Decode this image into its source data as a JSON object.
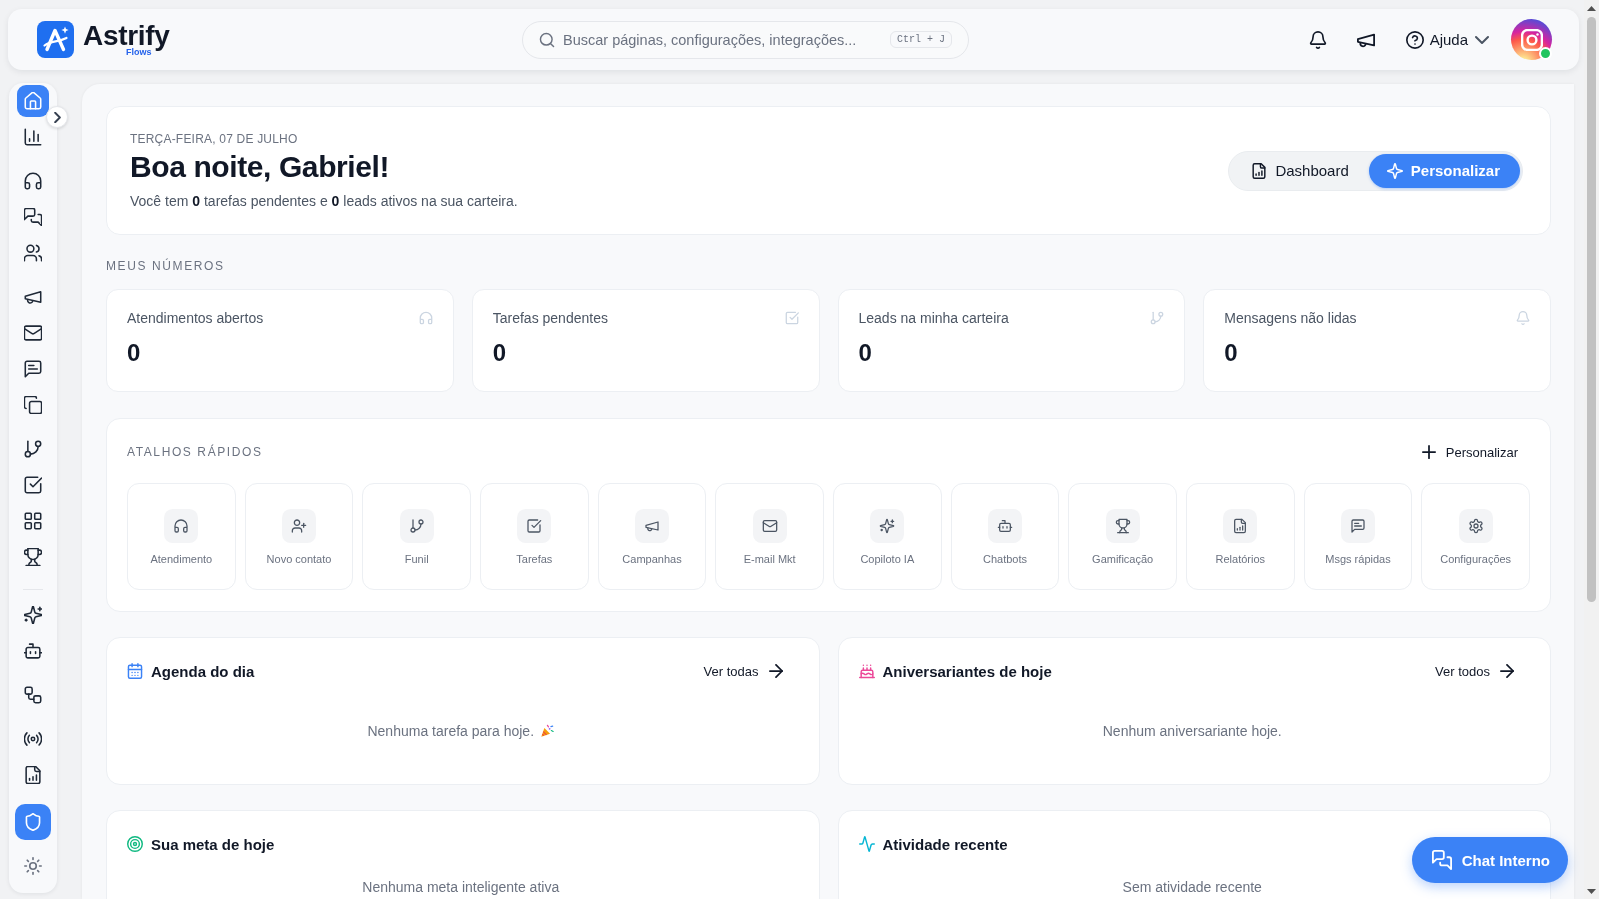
{
  "topbar": {
    "logo": {
      "name": "Astrify",
      "tagline": "Flows"
    },
    "search": {
      "placeholder": "Buscar páginas, configurações, integrações...",
      "shortcut": "Ctrl + J"
    },
    "help": {
      "label": "Ajuda"
    },
    "user": {
      "online": true
    }
  },
  "sidebar": {
    "groups": [
      {
        "divider": false,
        "items": [
          {
            "selected": true
          },
          {
            "selected": false
          }
        ]
      },
      {
        "divider": false,
        "items": [
          {
            "selected": false
          },
          {
            "selected": false
          },
          {
            "selected": false
          }
        ]
      },
      {
        "divider": false,
        "items": [
          {
            "selected": false
          },
          {
            "selected": false
          },
          {
            "selected": false
          },
          {
            "selected": false
          }
        ]
      },
      {
        "divider": false,
        "items": [
          {
            "selected": false
          },
          {
            "selected": false
          },
          {
            "selected": false
          },
          {
            "selected": false
          }
        ]
      },
      {
        "divider": true,
        "items": [
          {
            "selected": false
          },
          {
            "selected": false
          }
        ]
      },
      {
        "divider": false,
        "items": [
          {
            "selected": false
          }
        ]
      },
      {
        "divider": false,
        "items": [
          {
            "selected": false
          },
          {
            "selected": false
          }
        ]
      }
    ],
    "footer": [
      {
        "kind": "admin",
        "highlighted": true
      },
      {
        "kind": "theme",
        "highlighted": false
      }
    ]
  },
  "greeting": {
    "date": "TERÇA-FEIRA, 07 DE JULHO",
    "title": "Boa noite, Gabriel!",
    "summary": "Você tem **0** tarefas pendentes e **0** leads ativos na sua carteira.",
    "view_toggle": [
      {
        "label": "Dashboard",
        "selected": false
      },
      {
        "label": "Personalizar",
        "selected": true
      }
    ]
  },
  "my_numbers": {
    "title": "MEUS NÚMEROS",
    "cards": [
      {
        "label": "Atendimentos abertos",
        "value": "0"
      },
      {
        "label": "Tarefas pendentes",
        "value": "0"
      },
      {
        "label": "Leads na minha carteira",
        "value": "0"
      },
      {
        "label": "Mensagens não lidas",
        "value": "0"
      }
    ]
  },
  "shortcuts": {
    "title": "ATALHOS RÁPIDOS",
    "customize": "Personalizar",
    "items": [
      {
        "label": "Atendimento"
      },
      {
        "label": "Novo contato"
      },
      {
        "label": "Funil"
      },
      {
        "label": "Tarefas"
      },
      {
        "label": "Campanhas"
      },
      {
        "label": "E-mail Mkt"
      },
      {
        "label": "Copiloto IA"
      },
      {
        "label": "Chatbots"
      },
      {
        "label": "Gamificação"
      },
      {
        "label": "Relatórios"
      },
      {
        "label": "Msgs rápidas"
      },
      {
        "label": "Configurações"
      }
    ]
  },
  "panels": [
    {
      "title": "Agenda do dia",
      "link": "Ver todas",
      "empty": "Nenhuma tarefa para hoje."
    },
    {
      "title": "Aniversariantes de hoje",
      "link": "Ver todos",
      "empty": "Nenhum aniversariante hoje."
    },
    {
      "title": "Sua meta de hoje",
      "empty": "Nenhuma meta inteligente ativa"
    },
    {
      "title": "Atividade recente",
      "empty": "Sem atividade recente"
    }
  ],
  "chat_button": {
    "label": "Chat Interno"
  }
}
